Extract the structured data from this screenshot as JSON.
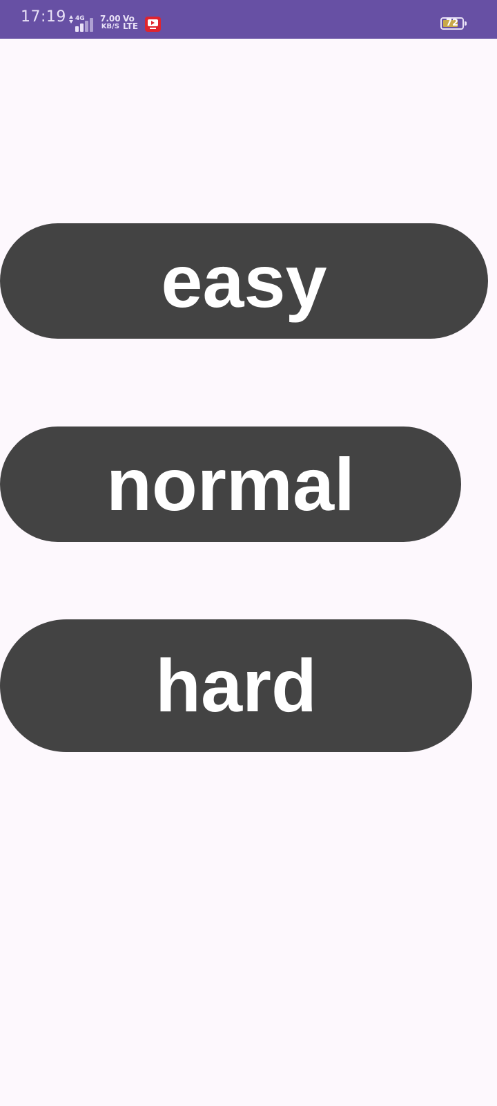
{
  "status_bar": {
    "time": "17:19",
    "network_type": "4G",
    "speed_value": "7.00",
    "speed_unit": "KB/S",
    "volte_top": "Vo",
    "volte_bottom": "LTE",
    "battery_level": "72",
    "background_color": "#6750a4",
    "icons": [
      "data-transfer-icon",
      "signal-icon",
      "youtube-icon",
      "battery-icon"
    ]
  },
  "levels": {
    "easy_label": "easy",
    "normal_label": "normal",
    "hard_label": "hard",
    "button_color": "#434343",
    "text_color": "#ffffff"
  },
  "page": {
    "background_color": "#fdf8fd"
  }
}
